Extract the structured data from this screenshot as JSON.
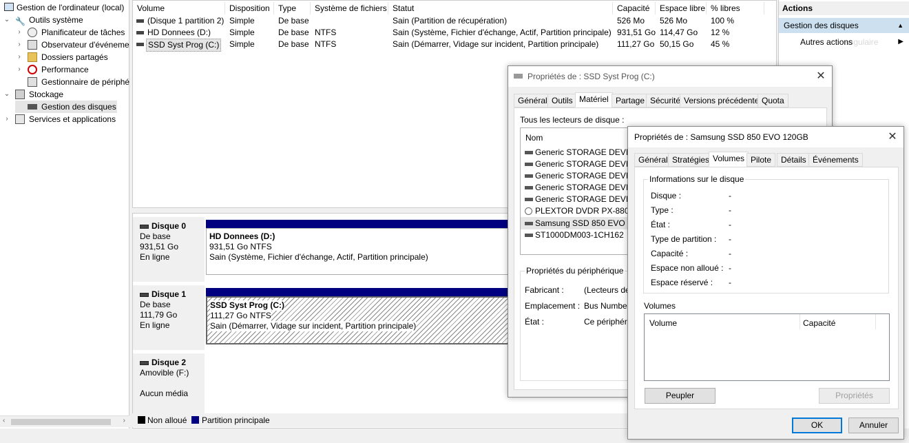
{
  "tree": {
    "root": "Gestion de l'ordinateur (local)",
    "items": [
      {
        "label": "Outils système"
      },
      {
        "label": "Planificateur de tâches"
      },
      {
        "label": "Observateur d'événeme"
      },
      {
        "label": "Dossiers partagés"
      },
      {
        "label": "Performance"
      },
      {
        "label": "Gestionnaire de périphé"
      },
      {
        "label": "Stockage"
      },
      {
        "label": "Gestion des disques"
      },
      {
        "label": "Services et applications"
      }
    ]
  },
  "volumes": {
    "headers": [
      "Volume",
      "Disposition",
      "Type",
      "Système de fichiers",
      "Statut",
      "Capacité",
      "Espace libre",
      "% libres"
    ],
    "rows": [
      {
        "name": "(Disque 1 partition 2)",
        "layout": "Simple",
        "type": "De base",
        "fs": "",
        "status": "Sain (Partition de récupération)",
        "cap": "526 Mo",
        "free": "526 Mo",
        "pct": "100 %"
      },
      {
        "name": "HD Donnees (D:)",
        "layout": "Simple",
        "type": "De base",
        "fs": "NTFS",
        "status": "Sain (Système, Fichier d'échange, Actif, Partition principale)",
        "cap": "931,51 Go",
        "free": "114,47 Go",
        "pct": "12 %"
      },
      {
        "name": "SSD Syst Prog (C:)",
        "layout": "Simple",
        "type": "De base",
        "fs": "NTFS",
        "status": "Sain (Démarrer, Vidage sur incident, Partition principale)",
        "cap": "111,27 Go",
        "free": "50,15 Go",
        "pct": "45 %"
      }
    ]
  },
  "disks": [
    {
      "label": "Disque 0",
      "type": "De base",
      "size": "931,51 Go",
      "state": "En ligne",
      "part_name": "HD Donnees  (D:)",
      "part_size": "931,51 Go NTFS",
      "part_status": "Sain (Système, Fichier d'échange, Actif, Partition principale)"
    },
    {
      "label": "Disque 1",
      "type": "De base",
      "size": "111,79 Go",
      "state": "En ligne",
      "part_name": "SSD Syst Prog  (C:)",
      "part_size": "111,27 Go NTFS",
      "part_status": "Sain (Démarrer, Vidage sur incident, Partition principale)"
    },
    {
      "label": "Disque 2",
      "type": "Amovible (F:)",
      "state": "Aucun média"
    }
  ],
  "legend": {
    "unalloc": "Non alloué",
    "primary": "Partition principale",
    "primary_color": "#000080"
  },
  "actions": {
    "title": "Actions",
    "section": "Gestion des disques",
    "more": "Autres actions",
    "ghost": "angulaire"
  },
  "dlg1": {
    "title": "Propriétés de : SSD Syst Prog (C:)",
    "tabs": [
      "Général",
      "Outils",
      "Matériel",
      "Partage",
      "Sécurité",
      "Versions précédentes",
      "Quota"
    ],
    "all_drives": "Tous les lecteurs de disque :",
    "col_name": "Nom",
    "drives": [
      "Generic STORAGE DEVICE",
      "Generic STORAGE DEVICE",
      "Generic STORAGE DEVICE",
      "Generic STORAGE DEVICE",
      "Generic STORAGE DEVICE",
      "PLEXTOR DVDR   PX-880S",
      "Samsung SSD 850 EVO 120",
      "ST1000DM003-1CH162"
    ],
    "props": "Propriétés du périphérique",
    "manufacturer": "Fabricant :",
    "manufacturer_val": "(Lecteurs de d",
    "location": "Emplacement :",
    "location_val": "Bus Number 4",
    "state": "État :",
    "state_val": "Ce périphériqu"
  },
  "dlg2": {
    "title": "Propriétés de : Samsung SSD 850 EVO 120GB",
    "tabs": [
      "Général",
      "Stratégies",
      "Volumes",
      "Pilote",
      "Détails",
      "Événements"
    ],
    "info": "Informations sur le disque",
    "fields": [
      {
        "k": "Disque :",
        "v": "-"
      },
      {
        "k": "Type :",
        "v": "-"
      },
      {
        "k": "État :",
        "v": "-"
      },
      {
        "k": "Type de partition :",
        "v": "-"
      },
      {
        "k": "Capacité :",
        "v": "-"
      },
      {
        "k": "Espace non alloué :",
        "v": "-"
      },
      {
        "k": "Espace réservé :",
        "v": "-"
      }
    ],
    "volumes": "Volumes",
    "col_volume": "Volume",
    "col_capacity": "Capacité",
    "populate": "Peupler",
    "properties": "Propriétés",
    "ok": "OK",
    "cancel": "Annuler"
  }
}
